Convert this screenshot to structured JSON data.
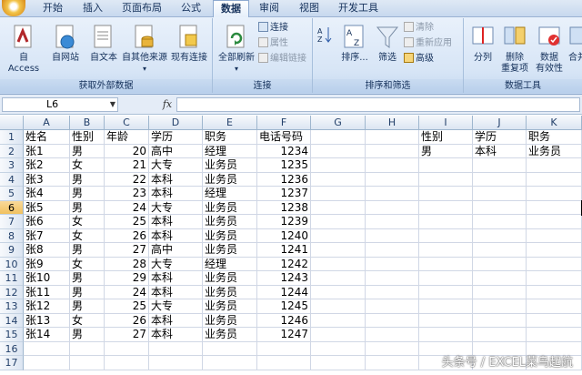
{
  "tabs": [
    "开始",
    "插入",
    "页面布局",
    "公式",
    "数据",
    "审阅",
    "视图",
    "开发工具"
  ],
  "active_tab_index": 4,
  "groups": {
    "external": {
      "label": "获取外部数据",
      "buttons": [
        "自 Access",
        "自网站",
        "自文本",
        "自其他来源",
        "现有连接"
      ]
    },
    "connections": {
      "label": "连接",
      "refresh": "全部刷新",
      "items": [
        "连接",
        "属性",
        "编辑链接"
      ]
    },
    "sortfilter": {
      "label": "排序和筛选",
      "sort": "排序...",
      "filter": "筛选",
      "items": [
        "清除",
        "重新应用",
        "高级"
      ]
    },
    "datatools": {
      "label": "数据工具",
      "split": "分列",
      "dedupe_line1": "删除",
      "dedupe_line2": "重复项",
      "validate_line1": "数据",
      "validate_line2": "有效性",
      "merge": "合并"
    }
  },
  "formula_bar": {
    "name_box": "L6",
    "fx": "fx",
    "value": ""
  },
  "columns": [
    "A",
    "B",
    "C",
    "D",
    "E",
    "F",
    "G",
    "H",
    "I",
    "J",
    "K"
  ],
  "selected_column": "L",
  "selected_row": 6,
  "rows": [
    [
      "姓名",
      "性别",
      "年龄",
      "学历",
      "职务",
      "电话号码",
      "",
      "",
      "性别",
      "学历",
      "职务"
    ],
    [
      "张1",
      "男",
      "20",
      "高中",
      "经理",
      "1234",
      "",
      "",
      "男",
      "本科",
      "业务员"
    ],
    [
      "张2",
      "女",
      "21",
      "大专",
      "业务员",
      "1235",
      "",
      "",
      "",
      "",
      ""
    ],
    [
      "张3",
      "男",
      "22",
      "本科",
      "业务员",
      "1236",
      "",
      "",
      "",
      "",
      ""
    ],
    [
      "张4",
      "男",
      "23",
      "本科",
      "经理",
      "1237",
      "",
      "",
      "",
      "",
      ""
    ],
    [
      "张5",
      "男",
      "24",
      "大专",
      "业务员",
      "1238",
      "",
      "",
      "",
      "",
      ""
    ],
    [
      "张6",
      "女",
      "25",
      "本科",
      "业务员",
      "1239",
      "",
      "",
      "",
      "",
      ""
    ],
    [
      "张7",
      "女",
      "26",
      "本科",
      "业务员",
      "1240",
      "",
      "",
      "",
      "",
      ""
    ],
    [
      "张8",
      "男",
      "27",
      "高中",
      "业务员",
      "1241",
      "",
      "",
      "",
      "",
      ""
    ],
    [
      "张9",
      "女",
      "28",
      "大专",
      "经理",
      "1242",
      "",
      "",
      "",
      "",
      ""
    ],
    [
      "张10",
      "男",
      "29",
      "本科",
      "业务员",
      "1243",
      "",
      "",
      "",
      "",
      ""
    ],
    [
      "张11",
      "男",
      "24",
      "本科",
      "业务员",
      "1244",
      "",
      "",
      "",
      "",
      ""
    ],
    [
      "张12",
      "男",
      "25",
      "大专",
      "业务员",
      "1245",
      "",
      "",
      "",
      "",
      ""
    ],
    [
      "张13",
      "女",
      "26",
      "本科",
      "业务员",
      "1246",
      "",
      "",
      "",
      "",
      ""
    ],
    [
      "张14",
      "男",
      "27",
      "本科",
      "业务员",
      "1247",
      "",
      "",
      "",
      "",
      ""
    ],
    [
      "",
      "",
      "",
      "",
      "",
      "",
      "",
      "",
      "",
      "",
      ""
    ],
    [
      "",
      "",
      "",
      "",
      "",
      "",
      "",
      "",
      "",
      "",
      ""
    ]
  ],
  "numeric_columns": [
    2,
    5
  ],
  "watermark": "头条号 / EXCEL菜鸟起航"
}
